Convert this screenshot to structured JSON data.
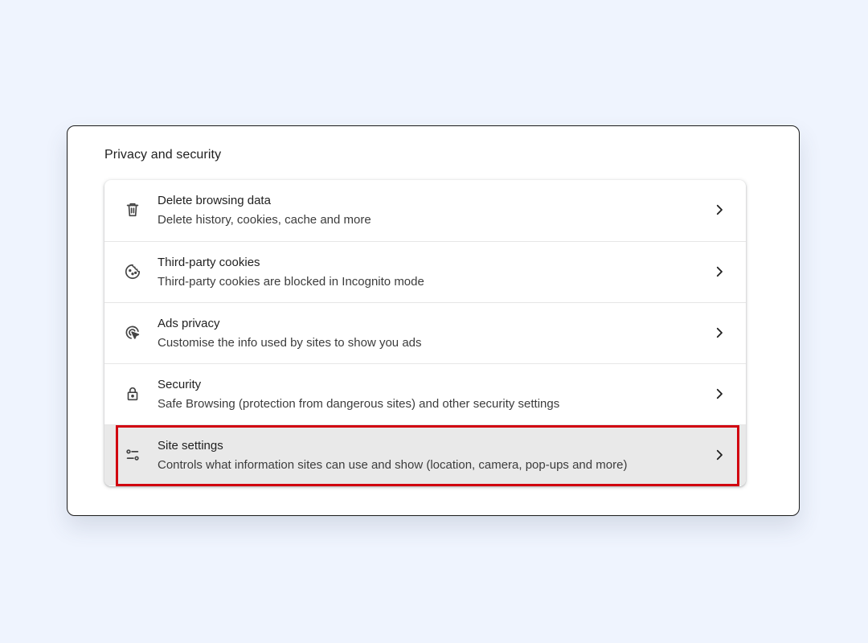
{
  "section": {
    "title": "Privacy and security"
  },
  "rows": [
    {
      "label": "Delete browsing data",
      "sublabel": "Delete history, cookies, cache and more",
      "icon": "trash-icon"
    },
    {
      "label": "Third-party cookies",
      "sublabel": "Third-party cookies are blocked in Incognito mode",
      "icon": "cookie-icon"
    },
    {
      "label": "Ads privacy",
      "sublabel": "Customise the info used by sites to show you ads",
      "icon": "ads-privacy-icon"
    },
    {
      "label": "Security",
      "sublabel": "Safe Browsing (protection from dangerous sites) and other security settings",
      "icon": "lock-icon"
    },
    {
      "label": "Site settings",
      "sublabel": "Controls what information sites can use and show (location, camera, pop-ups and more)",
      "icon": "sliders-icon",
      "highlighted": true
    }
  ],
  "colors": {
    "background": "#eff4fe",
    "highlight_border": "#d1000f",
    "highlight_row": "#e9e9e9"
  }
}
